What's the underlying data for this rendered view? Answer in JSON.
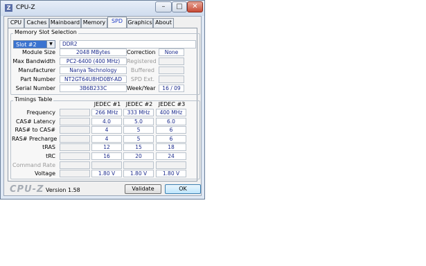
{
  "window": {
    "title": "CPU-Z",
    "app_icon": "Z"
  },
  "window_buttons": {
    "minimize": "–",
    "maximize": "□",
    "close": "✕"
  },
  "tabs": [
    "CPU",
    "Caches",
    "Mainboard",
    "Memory",
    "SPD",
    "Graphics",
    "About"
  ],
  "active_tab": "SPD",
  "memory_slot": {
    "group_title": "Memory Slot Selection",
    "slot_selected": "Slot #2",
    "memory_type": "DDR2",
    "rows": [
      {
        "label": "Module Size",
        "value": "2048 MBytes",
        "right_label": "Correction",
        "right_value": "None",
        "right_enabled": true
      },
      {
        "label": "Max Bandwidth",
        "value": "PC2-6400 (400 MHz)",
        "right_label": "Registered",
        "right_value": "",
        "right_enabled": false
      },
      {
        "label": "Manufacturer",
        "value": "Nanya Technology",
        "right_label": "Buffered",
        "right_value": "",
        "right_enabled": false
      },
      {
        "label": "Part Number",
        "value": "NT2GT64U8HD0BY-AD",
        "right_label": "SPD Ext.",
        "right_value": "",
        "right_enabled": false
      },
      {
        "label": "Serial Number",
        "value": "3B6B233C",
        "right_label": "Week/Year",
        "right_value": "16 / 09",
        "right_enabled": true
      }
    ]
  },
  "timings": {
    "group_title": "Timings Table",
    "columns": [
      "JEDEC #1",
      "JEDEC #2",
      "JEDEC #3"
    ],
    "rows": [
      {
        "label": "Frequency",
        "values": [
          "266 MHz",
          "333 MHz",
          "400 MHz"
        ],
        "enabled": true
      },
      {
        "label": "CAS# Latency",
        "values": [
          "4.0",
          "5.0",
          "6.0"
        ],
        "enabled": true
      },
      {
        "label": "RAS# to CAS#",
        "values": [
          "4",
          "5",
          "6"
        ],
        "enabled": true
      },
      {
        "label": "RAS# Precharge",
        "values": [
          "4",
          "5",
          "6"
        ],
        "enabled": true
      },
      {
        "label": "tRAS",
        "values": [
          "12",
          "15",
          "18"
        ],
        "enabled": true
      },
      {
        "label": "tRC",
        "values": [
          "16",
          "20",
          "24"
        ],
        "enabled": true
      },
      {
        "label": "Command Rate",
        "values": [
          "",
          "",
          ""
        ],
        "enabled": false
      },
      {
        "label": "Voltage",
        "values": [
          "1.80 V",
          "1.80 V",
          "1.80 V"
        ],
        "enabled": true
      }
    ]
  },
  "footer": {
    "brand": "CPU-Z",
    "version": "Version 1.58",
    "validate_label": "Validate",
    "ok_label": "OK"
  }
}
